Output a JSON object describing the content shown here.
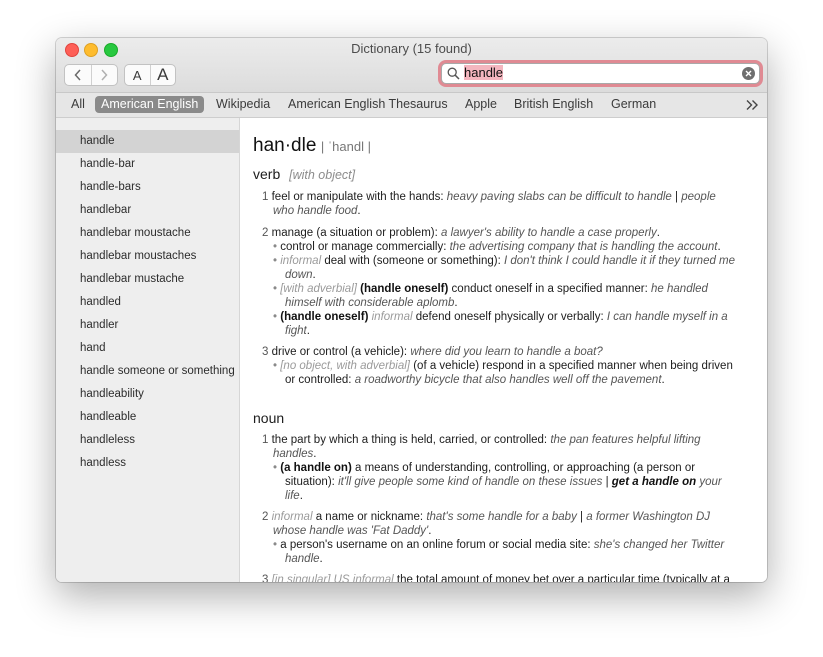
{
  "window": {
    "title": "Dictionary (15 found)",
    "colors": {
      "close": "#fe5f57",
      "minimize": "#febc2e",
      "zoom": "#28c840",
      "search_focus_ring": "#e08a93",
      "scope_active": "#8a8a8a"
    }
  },
  "toolbar": {
    "back_icon": "chevron-left-icon",
    "forward_icon": "chevron-right-icon",
    "font_smaller_label": "A",
    "font_larger_label": "A"
  },
  "search": {
    "value": "handle",
    "search_icon": "magnifier-icon",
    "clear_icon": "clear-circle-icon"
  },
  "scopes": {
    "tabs": [
      "All",
      "American English",
      "Wikipedia",
      "American English Thesaurus",
      "Apple",
      "British English",
      "German"
    ],
    "active": "American English",
    "more_icon": "double-chevron-right-icon"
  },
  "sidebar": {
    "items": [
      "handle",
      "handle-bar",
      "handle-bars",
      "handlebar",
      "handlebar moustache",
      "handlebar moustaches",
      "handlebar mustache",
      "handled",
      "handler",
      "hand",
      "handle someone or something",
      "handleability",
      "handleable",
      "handleless",
      "handless"
    ],
    "selected": "handle"
  },
  "entry": {
    "headword": "han·dle",
    "pronunciation": "| ˈhandl |",
    "verb": {
      "pos": "verb",
      "grammar": "[with object]",
      "s1_num": "1",
      "s1_def": "feel or manipulate with the hands:",
      "s1_ex_a": "heavy paving slabs can be difficult to handle",
      "s1_sep": "|",
      "s1_ex_b": "people",
      "s1_ex_c": "who handle food",
      "s1_end": ".",
      "s2_num": "2",
      "s2_def": "manage (a situation or problem):",
      "s2_ex": "a lawyer's ability to handle a case properly",
      "s2_end": ".",
      "s2a_def": "control or manage commercially:",
      "s2a_ex": "the advertising company that is handling the account",
      "s2a_end": ".",
      "s2b_label": "informal",
      "s2b_def": "deal with (someone or something):",
      "s2b_ex_a": "I don't think I could handle it if they turned me",
      "s2b_ex_b": "down",
      "s2b_end": ".",
      "s2c_label": "[with adverbial]",
      "s2c_phrase": "(handle oneself)",
      "s2c_def": "conduct oneself in a specified manner:",
      "s2c_ex_a": "he handled",
      "s2c_ex_b": "himself with considerable aplomb",
      "s2c_end": ".",
      "s2d_phrase": "(handle oneself)",
      "s2d_label": "informal",
      "s2d_def": "defend oneself physically or verbally:",
      "s2d_ex_a": "I can handle myself in a",
      "s2d_ex_b": "fight",
      "s2d_end": ".",
      "s3_num": "3",
      "s3_def": "drive or control (a vehicle):",
      "s3_ex": "where did you learn to handle a boat?",
      "s3a_label": "[no object, with adverbial]",
      "s3a_def": "(of a vehicle) respond in a specified manner when being driven",
      "s3a_def_b": "or controlled:",
      "s3a_ex": "a roadworthy bicycle that also handles well off the pavement",
      "s3a_end": "."
    },
    "noun": {
      "pos": "noun",
      "s1_num": "1",
      "s1_def": "the part by which a thing is held, carried, or controlled:",
      "s1_ex_a": "the pan features helpful lifting",
      "s1_ex_b": "handles",
      "s1_end": ".",
      "s1a_phrase": "(a handle on)",
      "s1a_def": "a means of understanding, controlling, or approaching (a person or",
      "s1a_def_b": "situation):",
      "s1a_ex": "it'll give people some kind of handle on these issues",
      "s1a_sep": "|",
      "s1a_ex_bold": "get a handle on",
      "s1a_ex_c": "your",
      "s1a_ex_d": "life",
      "s1a_end": ".",
      "s2_num": "2",
      "s2_label": "informal",
      "s2_def": "a name or nickname:",
      "s2_ex_a": "that's some handle for a baby",
      "s2_sep": "|",
      "s2_ex_b": "a former Washington DJ",
      "s2_ex_c": "whose handle was 'Fat Daddy'",
      "s2_end": ".",
      "s2a_def": "a person's username on an online forum or social media site:",
      "s2a_ex_a": "she's changed her Twitter",
      "s2a_ex_b": "handle",
      "s2a_end": ".",
      "s3_num": "3",
      "s3_label": "[in singular] US informal",
      "s3_def": "the total amount of money bet over a particular time (typically at a"
    }
  }
}
